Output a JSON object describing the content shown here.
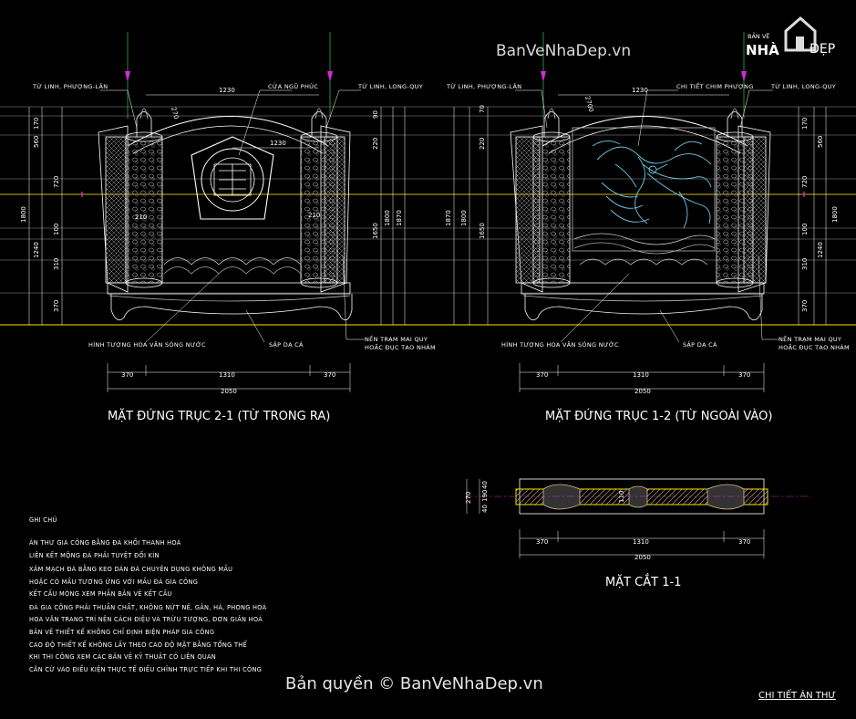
{
  "watermark_top": "BanVeNhaDep.vn",
  "logo": {
    "small": "BẢN VẼ",
    "main": "NHÀ",
    "suffix": "ĐẸP"
  },
  "copyright": "Bản quyền © BanVeNhaDep.vn",
  "sheet_title": "CHI TIẾT ÁN THƯ",
  "colors": {
    "line": "#ffffff",
    "axis": "#c8b400",
    "green": "#2bb24c",
    "magenta": "#d42ad4",
    "yellow": "#ffe000",
    "cyan": "#6fc8e6"
  },
  "left_view": {
    "title": "MẶT ĐỨNG TRỤC 2-1 (TỪ TRONG RA)",
    "labels": {
      "tl": "TỨ LINH, PHƯỢNG-LÂN",
      "tc": "CỬA NGŨ PHÚC",
      "tr": "TỨ LINH, LONG-QUY",
      "bl": "HÌNH TƯỢNG HOA VĂN SÓNG NƯỚC",
      "bc": "SẬP DẠ CÁ",
      "br1": "NỀN TRẠM MAI QUY",
      "br2": "HOẶC ĐỤC TẠO NHÁM"
    },
    "dims_left": [
      "170",
      "560",
      "720",
      "1800",
      "100",
      "310",
      "1240",
      "370"
    ],
    "dims_top": [
      "1230",
      "1230"
    ],
    "dims_right": [
      "90",
      "220",
      "1650",
      "1800",
      "1870"
    ],
    "dims_bottom": [
      "370",
      "1310",
      "370",
      "2050"
    ],
    "inner": [
      "270",
      "210",
      "210"
    ]
  },
  "right_view": {
    "title": "MẶT ĐỨNG TRỤC 1-2 (TỪ NGOÀI VÀO)",
    "labels": {
      "tl": "TỨ LINH, PHƯỢNG-LÂN",
      "tc": "CHI TIẾT CHIM PHƯỢNG",
      "tr": "TỨ LINH, LONG-QUY",
      "bl": "HÌNH TƯỢNG HOA VĂN SÓNG NƯỚC",
      "bc": "SẬP DẠ CÁ",
      "br1": "NỀN TRẠM MAI QUY",
      "br2": "HOẶC ĐỤC TẠO NHÁM"
    },
    "dims_left": [
      "1870",
      "1800",
      "1650",
      "220",
      "70"
    ],
    "dims_top": [
      "1230"
    ],
    "dims_right": [
      "170",
      "560",
      "720",
      "1800",
      "100",
      "310",
      "1240",
      "370"
    ],
    "dims_bottom": [
      "370",
      "1310",
      "370",
      "2050"
    ],
    "inner": [
      "2700"
    ]
  },
  "section": {
    "title": "MẶT CẮT 1-1",
    "dims_left": [
      "270",
      "40",
      "190",
      "40"
    ],
    "inner": "110",
    "dims_bottom": [
      "370",
      "1310",
      "370",
      "2050"
    ]
  },
  "notes": {
    "heading": "GHI CHÚ",
    "lines": [
      "ÁN THƯ GIA CÔNG BẰNG ĐÁ KHỐI THANH HOÁ",
      "LIÊN KẾT MỘNG ĐÁ PHẢI TUYỆT ĐỐI KÍN",
      "XẢM MẠCH ĐÁ BẰNG KEO DÁN ĐÁ CHUYÊN DỤNG KHÔNG MẦU",
      "HOẶC CÓ MẦU TƯƠNG ỨNG VỚI MẦU ĐÁ GIA CÔNG",
      "KẾT CẤU MÓNG XEM PHẦN BẢN VẼ KẾT CẤU",
      "ĐÁ GIA CÔNG PHẢI THUẦN CHẤT, KHÔNG NỨT NẺ, GÂN, HÀ, PHONG HOÁ",
      "HOA VĂN TRANG TRÍ NÊN CÁCH ĐIỆU VÀ TRỪU TƯỢNG, ĐƠN GIẢN HOÁ",
      "BẢN VẼ THIẾT KẾ KHÔNG CHỈ ĐỊNH BIỆN PHÁP GIA CÔNG",
      "CAO ĐỘ THIẾT KẾ KHÔNG LẤY THEO CAO ĐỘ MẶT BẰNG TỔNG THỂ",
      "KHI THI CÔNG XEM CÁC BẢN VẼ KỸ THUẬT CÓ LIÊN QUAN",
      "CĂN CỨ VÀO ĐIỀU KIỆN THỰC TẾ ĐIỀU CHỈNH TRỰC TIẾP KHI THI CÔNG"
    ]
  }
}
